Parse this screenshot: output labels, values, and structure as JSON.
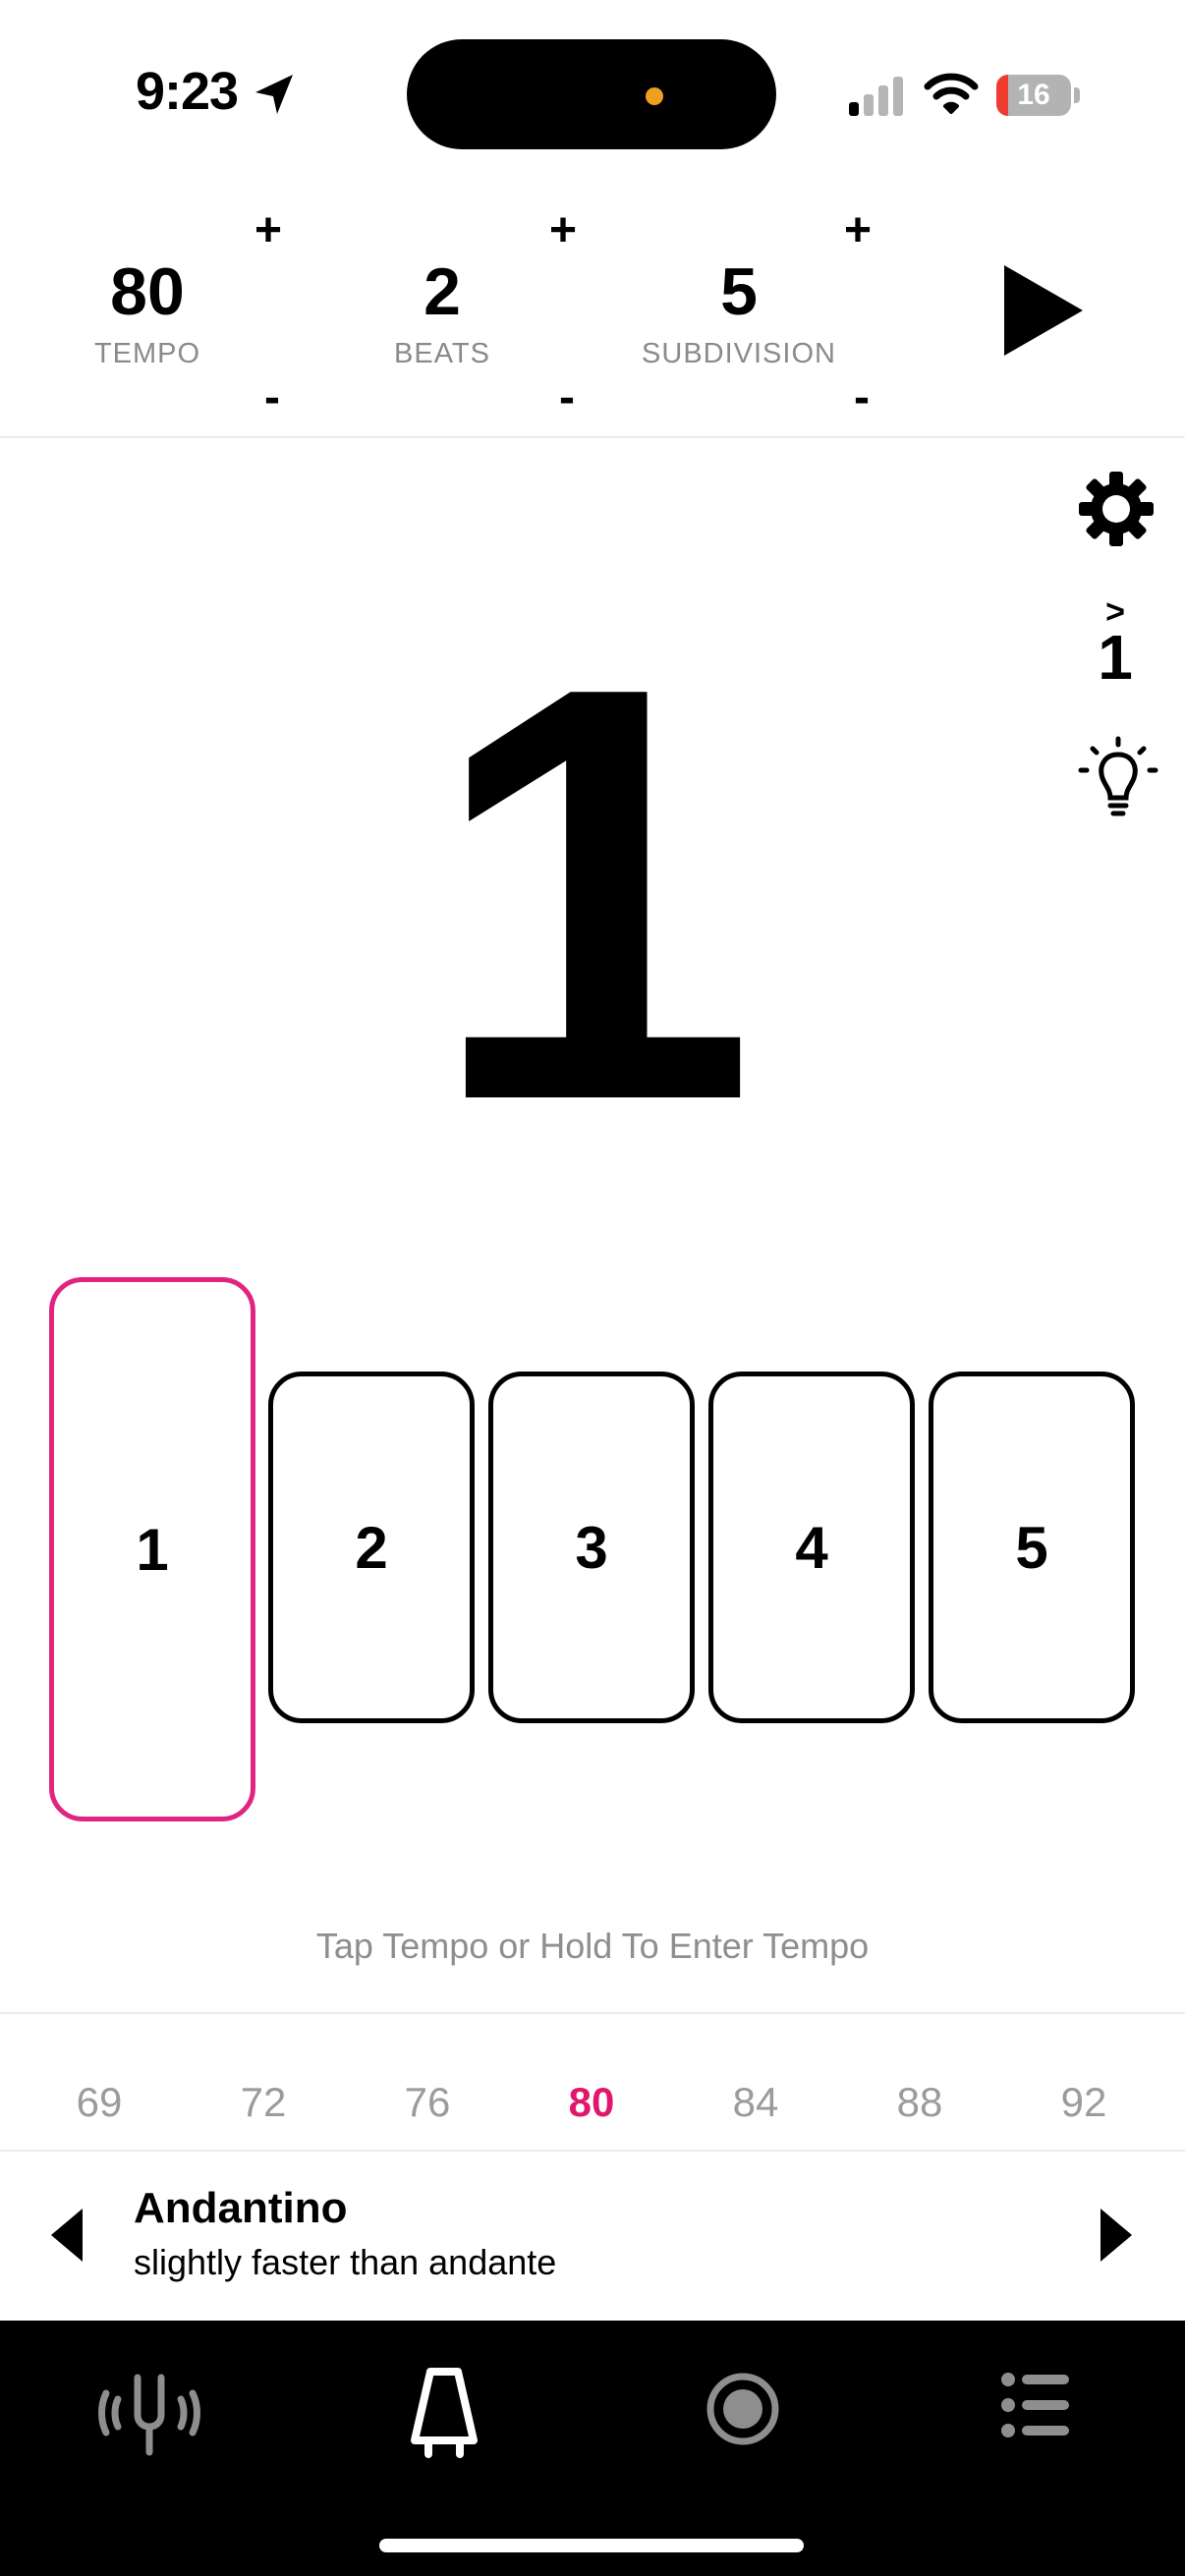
{
  "status_bar": {
    "time": "9:23",
    "battery": "16",
    "battery_level": 0.16
  },
  "controls": [
    {
      "value": "80",
      "label": "TEMPO",
      "plus": "+",
      "minus": "-"
    },
    {
      "value": "2",
      "label": "BEATS",
      "plus": "+",
      "minus": "-"
    },
    {
      "value": "5",
      "label": "SUBDIVISION",
      "plus": "+",
      "minus": "-"
    }
  ],
  "side": {
    "accent_mark": ">",
    "accent_number": "1"
  },
  "current_beat": "1",
  "beat_cards": [
    "1",
    "2",
    "3",
    "4",
    "5"
  ],
  "active_beat_index": 0,
  "hint": "Tap Tempo or Hold To Enter Tempo",
  "tempo_options": [
    "69",
    "72",
    "76",
    "80",
    "84",
    "88",
    "92"
  ],
  "selected_tempo": "80",
  "term": {
    "name": "Andantino",
    "description": "slightly faster than andante"
  },
  "tabs": [
    "tuner-icon",
    "metronome-icon",
    "record-icon",
    "list-icon"
  ],
  "colors": {
    "accent": "#e0247f",
    "selected_tempo": "#e0186d",
    "battery_low": "#ee3b30"
  }
}
